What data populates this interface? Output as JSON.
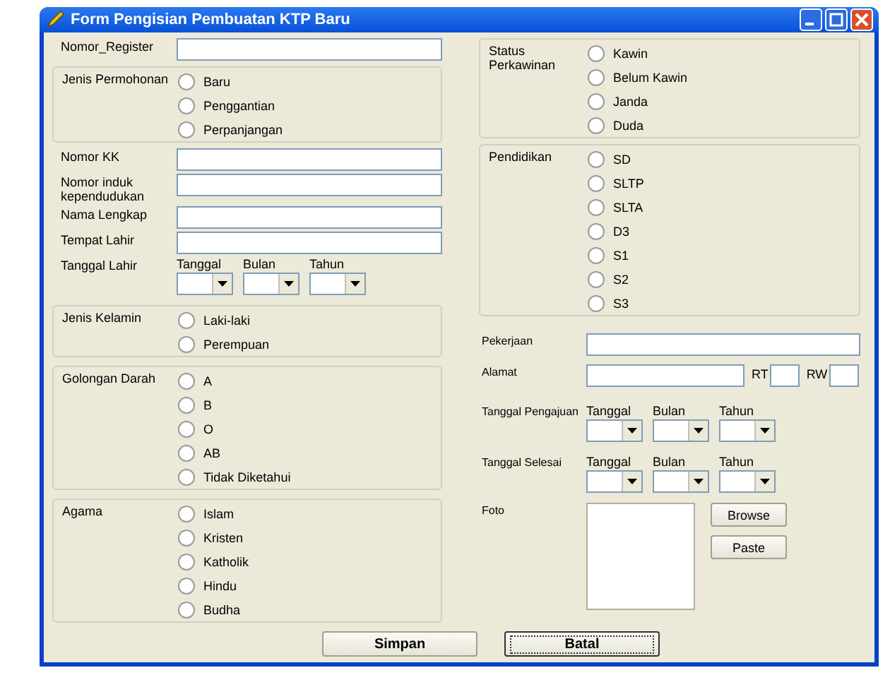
{
  "window": {
    "title": "Form Pengisian Pembuatan KTP Baru"
  },
  "left": [
    {
      "kind": "text",
      "label": "Nomor_Register"
    },
    {
      "kind": "radios",
      "label": "Jenis Permohonan",
      "options": [
        {
          "label": "Baru",
          "selected": false
        },
        {
          "label": "Penggantian",
          "selected": false
        },
        {
          "label": "Perpanjangan",
          "selected": false
        }
      ]
    },
    {
      "kind": "text",
      "label": "Nomor KK"
    },
    {
      "kind": "text",
      "label": "Nomor induk kependudukan"
    },
    {
      "kind": "text",
      "label": "Nama Lengkap"
    },
    {
      "kind": "text",
      "label": "Tempat Lahir"
    },
    {
      "kind": "date",
      "label": "Tanggal Lahir",
      "parts": [
        "Tanggal",
        "Bulan",
        "Tahun"
      ]
    },
    {
      "kind": "radios",
      "label": "Jenis Kelamin",
      "options": [
        {
          "label": "Laki-laki",
          "selected": false
        },
        {
          "label": "Perempuan",
          "selected": false
        }
      ]
    },
    {
      "kind": "radios",
      "label": "Golongan Darah",
      "options": [
        {
          "label": "A",
          "selected": false
        },
        {
          "label": "B",
          "selected": false
        },
        {
          "label": "O",
          "selected": false
        },
        {
          "label": "AB",
          "selected": false
        },
        {
          "label": "Tidak Diketahui",
          "selected": false
        }
      ]
    },
    {
      "kind": "radios",
      "label": "Agama",
      "options": [
        {
          "label": "Islam",
          "selected": false
        },
        {
          "label": "Kristen",
          "selected": false
        },
        {
          "label": "Katholik",
          "selected": false
        },
        {
          "label": "Hindu",
          "selected": false
        },
        {
          "label": "Budha",
          "selected": false
        }
      ]
    }
  ],
  "right": [
    {
      "kind": "radios",
      "label": "Status Perkawinan",
      "options": [
        {
          "label": "Kawin",
          "selected": false
        },
        {
          "label": "Belum Kawin",
          "selected": false
        },
        {
          "label": "Janda",
          "selected": false
        },
        {
          "label": "Duda",
          "selected": false
        }
      ]
    },
    {
      "kind": "radios",
      "label": "Pendidikan",
      "options": [
        {
          "label": "SD",
          "selected": false
        },
        {
          "label": "SLTP",
          "selected": false
        },
        {
          "label": "SLTA",
          "selected": false
        },
        {
          "label": "D3",
          "selected": false
        },
        {
          "label": "S1",
          "selected": false
        },
        {
          "label": "S2",
          "selected": false
        },
        {
          "label": "S3",
          "selected": false
        }
      ]
    },
    {
      "kind": "text",
      "label": "Pekerjaan"
    },
    {
      "kind": "address",
      "label": "Alamat",
      "rt": "RT",
      "rw": "RW"
    },
    {
      "kind": "date",
      "label": "Tanggal Pengajuan",
      "parts": [
        "Tanggal",
        "Bulan",
        "Tahun"
      ]
    },
    {
      "kind": "date",
      "label": "Tanggal Selesai",
      "parts": [
        "Tanggal",
        "Bulan",
        "Tahun"
      ]
    },
    {
      "kind": "photo",
      "label": "Foto",
      "buttons": [
        "Browse",
        "Paste"
      ]
    }
  ],
  "buttons": [
    {
      "label": "Simpan",
      "focused": false
    },
    {
      "label": "Batal",
      "focused": true
    }
  ]
}
